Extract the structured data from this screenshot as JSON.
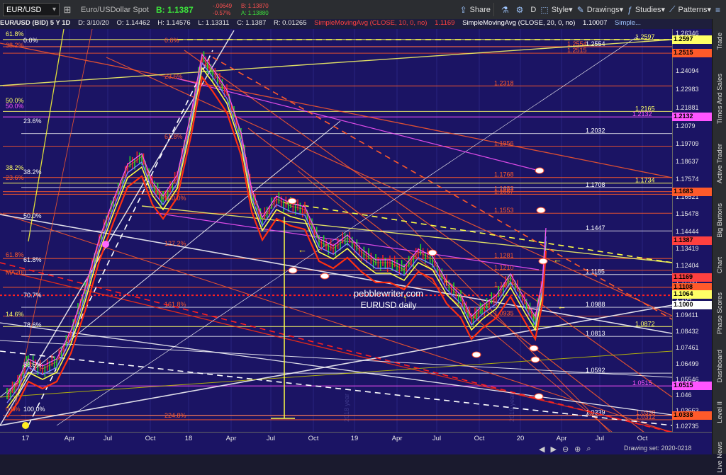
{
  "toolbar": {
    "symbol": "EUR/USD",
    "description": "Euro/USDollar Spot",
    "last": "B: 1.1387",
    "change": "-.00649",
    "change_pct": "-0.57%",
    "bid": "B: 1.13870",
    "ask": "A: 1.13880",
    "share": "Share",
    "interval": "D",
    "style": "Style",
    "drawings": "Drawings",
    "studies": "Studies",
    "patterns": "Patterns"
  },
  "infobar": {
    "symbol": "EUR/USD (BID) 5 Y 1D",
    "date": "D: 3/10/20",
    "open": "O: 1.14462",
    "high": "H: 1.14576",
    "low": "L: 1.13311",
    "close": "C: 1.1387",
    "range": "R: 0.01265",
    "sma10": "SimpleMovingAvg (CLOSE, 10, 0, no)",
    "sma10_val": "1.1169",
    "sma20": "SimpleMovingAvg (CLOSE, 20, 0, no)",
    "sma20_val": "1.10007",
    "trail": "Simple..."
  },
  "price_axis": [
    "1.26346",
    "1.25215",
    "1.24094",
    "1.22983",
    "1.21881",
    "1.2079",
    "1.19709",
    "1.18637",
    "1.17574",
    "1.16521",
    "1.15478",
    "1.14444",
    "1.13419",
    "1.12404",
    "1.11397",
    "1.104",
    "1.09411",
    "1.08432",
    "1.07461",
    "1.06499",
    "1.05546",
    "1.046",
    "1.03663",
    "1.02735"
  ],
  "axis_badges": [
    {
      "label": "1.2597",
      "color": "#ffff66"
    },
    {
      "label": "1.2515",
      "color": "#ff5a2a"
    },
    {
      "label": "1.2132",
      "color": "#ff55ff"
    },
    {
      "label": "1.1683",
      "color": "#ff5a2a"
    },
    {
      "label": "1.1387",
      "color": "#ff4040"
    },
    {
      "label": "1.1169",
      "color": "#ff4040"
    },
    {
      "label": "1.1108",
      "color": "#ff5a2a"
    },
    {
      "label": "1.1064",
      "color": "#ffff66"
    },
    {
      "label": "1.1000",
      "color": "#ffffff"
    },
    {
      "label": "1.0515",
      "color": "#ff55ff"
    },
    {
      "label": "1.0338",
      "color": "#ff5a2a"
    }
  ],
  "time_axis": [
    "17",
    "Apr",
    "Jul",
    "Oct",
    "18",
    "Apr",
    "Jul",
    "Oct",
    "19",
    "Apr",
    "Jul",
    "Oct",
    "20",
    "Apr",
    "Jul",
    "Oct"
  ],
  "levels": [
    {
      "label": "1.2597",
      "color": "#ffff66"
    },
    {
      "label": "1.2554",
      "color": "#ffffff"
    },
    {
      "label": "1.2554",
      "color": "#ff5a2a"
    },
    {
      "label": "1.2515",
      "color": "#ff5a2a"
    },
    {
      "label": "1.2318",
      "color": "#ff5a2a"
    },
    {
      "label": "1.2165",
      "color": "#ffff66"
    },
    {
      "label": "1.2132",
      "color": "#ff55ff"
    },
    {
      "label": "1.2032",
      "color": "#ffffff"
    },
    {
      "label": "1.1956",
      "color": "#ff5a2a"
    },
    {
      "label": "1.1768",
      "color": "#ff5a2a"
    },
    {
      "label": "1.1734",
      "color": "#ffff66"
    },
    {
      "label": "1.1708",
      "color": "#ffffff"
    },
    {
      "label": "1.1683",
      "color": "#ff5a2a"
    },
    {
      "label": "1.1667",
      "color": "#ff5a2a"
    },
    {
      "label": "1.1553",
      "color": "#ff5a2a"
    },
    {
      "label": "1.1447",
      "color": "#ffffff"
    },
    {
      "label": "1.1281",
      "color": "#ff5a2a"
    },
    {
      "label": "1.1210",
      "color": "#ff5a2a"
    },
    {
      "label": "1.1185",
      "color": "#ffffff"
    },
    {
      "label": "1.1108",
      "color": "#ff5a2a"
    },
    {
      "label": "1.0988",
      "color": "#ffffff"
    },
    {
      "label": "1.0935",
      "color": "#ff5a2a"
    },
    {
      "label": "1.0872",
      "color": "#ffff66"
    },
    {
      "label": "1.0813",
      "color": "#ffffff"
    },
    {
      "label": "1.0592",
      "color": "#ffffff"
    },
    {
      "label": "1.0515",
      "color": "#ff55ff"
    },
    {
      "label": "1.0339",
      "color": "#ffffff"
    },
    {
      "label": "1.0338",
      "color": "#ff5a2a"
    },
    {
      "label": "1.0312",
      "color": "#ff5a2a"
    }
  ],
  "fib_labels": [
    "61.8%",
    "0.0%",
    "38.2%",
    "23.6%",
    "50.0%",
    "50.0%",
    "23.6%",
    "61.8%",
    "38.2%",
    "23.6%",
    "38.2%",
    "100.0%",
    "50.0%",
    "127.2%",
    "61.8%",
    "61.8%",
    "MA200",
    "70.7%",
    "161.8%",
    "14.6%",
    "78.6%",
    "88.6%",
    "0.0%",
    "100.0%",
    "224.8%",
    "0.0%"
  ],
  "annotation": {
    "line1": "pebblewriter.com",
    "line2": "EURUSD daily"
  },
  "watermarks": [
    "2018 year",
    "2019 year"
  ],
  "bottom": {
    "drawing_set": "Drawing set: 2020-0218"
  },
  "sidebar": [
    "Trade",
    "Times And Sales",
    "Active Trader",
    "Big Buttons",
    "Chart",
    "Phase Scores",
    "Dashboard",
    "Level II",
    "Live News"
  ]
}
